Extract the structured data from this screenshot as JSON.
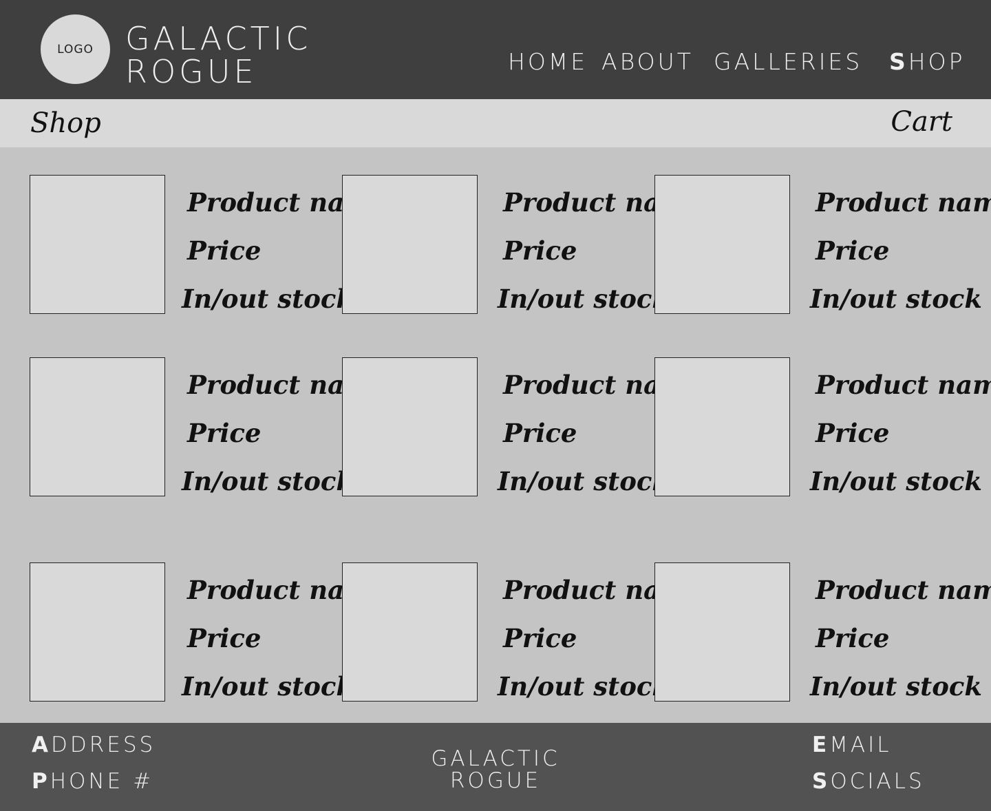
{
  "header": {
    "logo_text": "LOGO",
    "brand_line1": "GALACTIC",
    "brand_line2": "ROGUE",
    "nav": [
      {
        "first": "H",
        "rest": "OME"
      },
      {
        "first": "A",
        "rest": "BOUT"
      },
      {
        "first": "G",
        "rest": "ALLERIES"
      },
      {
        "first": "S",
        "rest": "HOP"
      }
    ],
    "active_nav": "SHOP"
  },
  "subheader": {
    "title": "Shop",
    "cart_label": "Cart"
  },
  "products": [
    {
      "name": "Product name",
      "price": "Price",
      "stock": "In/out stock"
    },
    {
      "name": "Product name",
      "price": "Price",
      "stock": "In/out stock"
    },
    {
      "name": "Product name",
      "price": "Price",
      "stock": "In/out stock"
    },
    {
      "name": "Product name",
      "price": "Price",
      "stock": "In/out stock"
    },
    {
      "name": "Product name",
      "price": "Price",
      "stock": "In/out stock"
    },
    {
      "name": "Product name",
      "price": "Price",
      "stock": "In/out stock"
    },
    {
      "name": "Product name",
      "price": "Price",
      "stock": "In/out stock"
    },
    {
      "name": "Product name",
      "price": "Price",
      "stock": "In/out stock"
    },
    {
      "name": "Product name",
      "price": "Price",
      "stock": "In/out stock"
    }
  ],
  "footer": {
    "address": {
      "first": "A",
      "rest": "DDRESS"
    },
    "phone": {
      "first": "P",
      "rest": "HONE #"
    },
    "brand_line1": "GALACTIC",
    "brand_line2": "ROGUE",
    "email": {
      "first": "E",
      "rest": "MAIL"
    },
    "socials": {
      "first": "S",
      "rest": "OCIALS"
    }
  },
  "colors": {
    "header_bg": "#3f3f3f",
    "subbar_bg": "#d9d9d9",
    "body_bg": "#c4c4c4",
    "footer_bg": "#525252"
  }
}
